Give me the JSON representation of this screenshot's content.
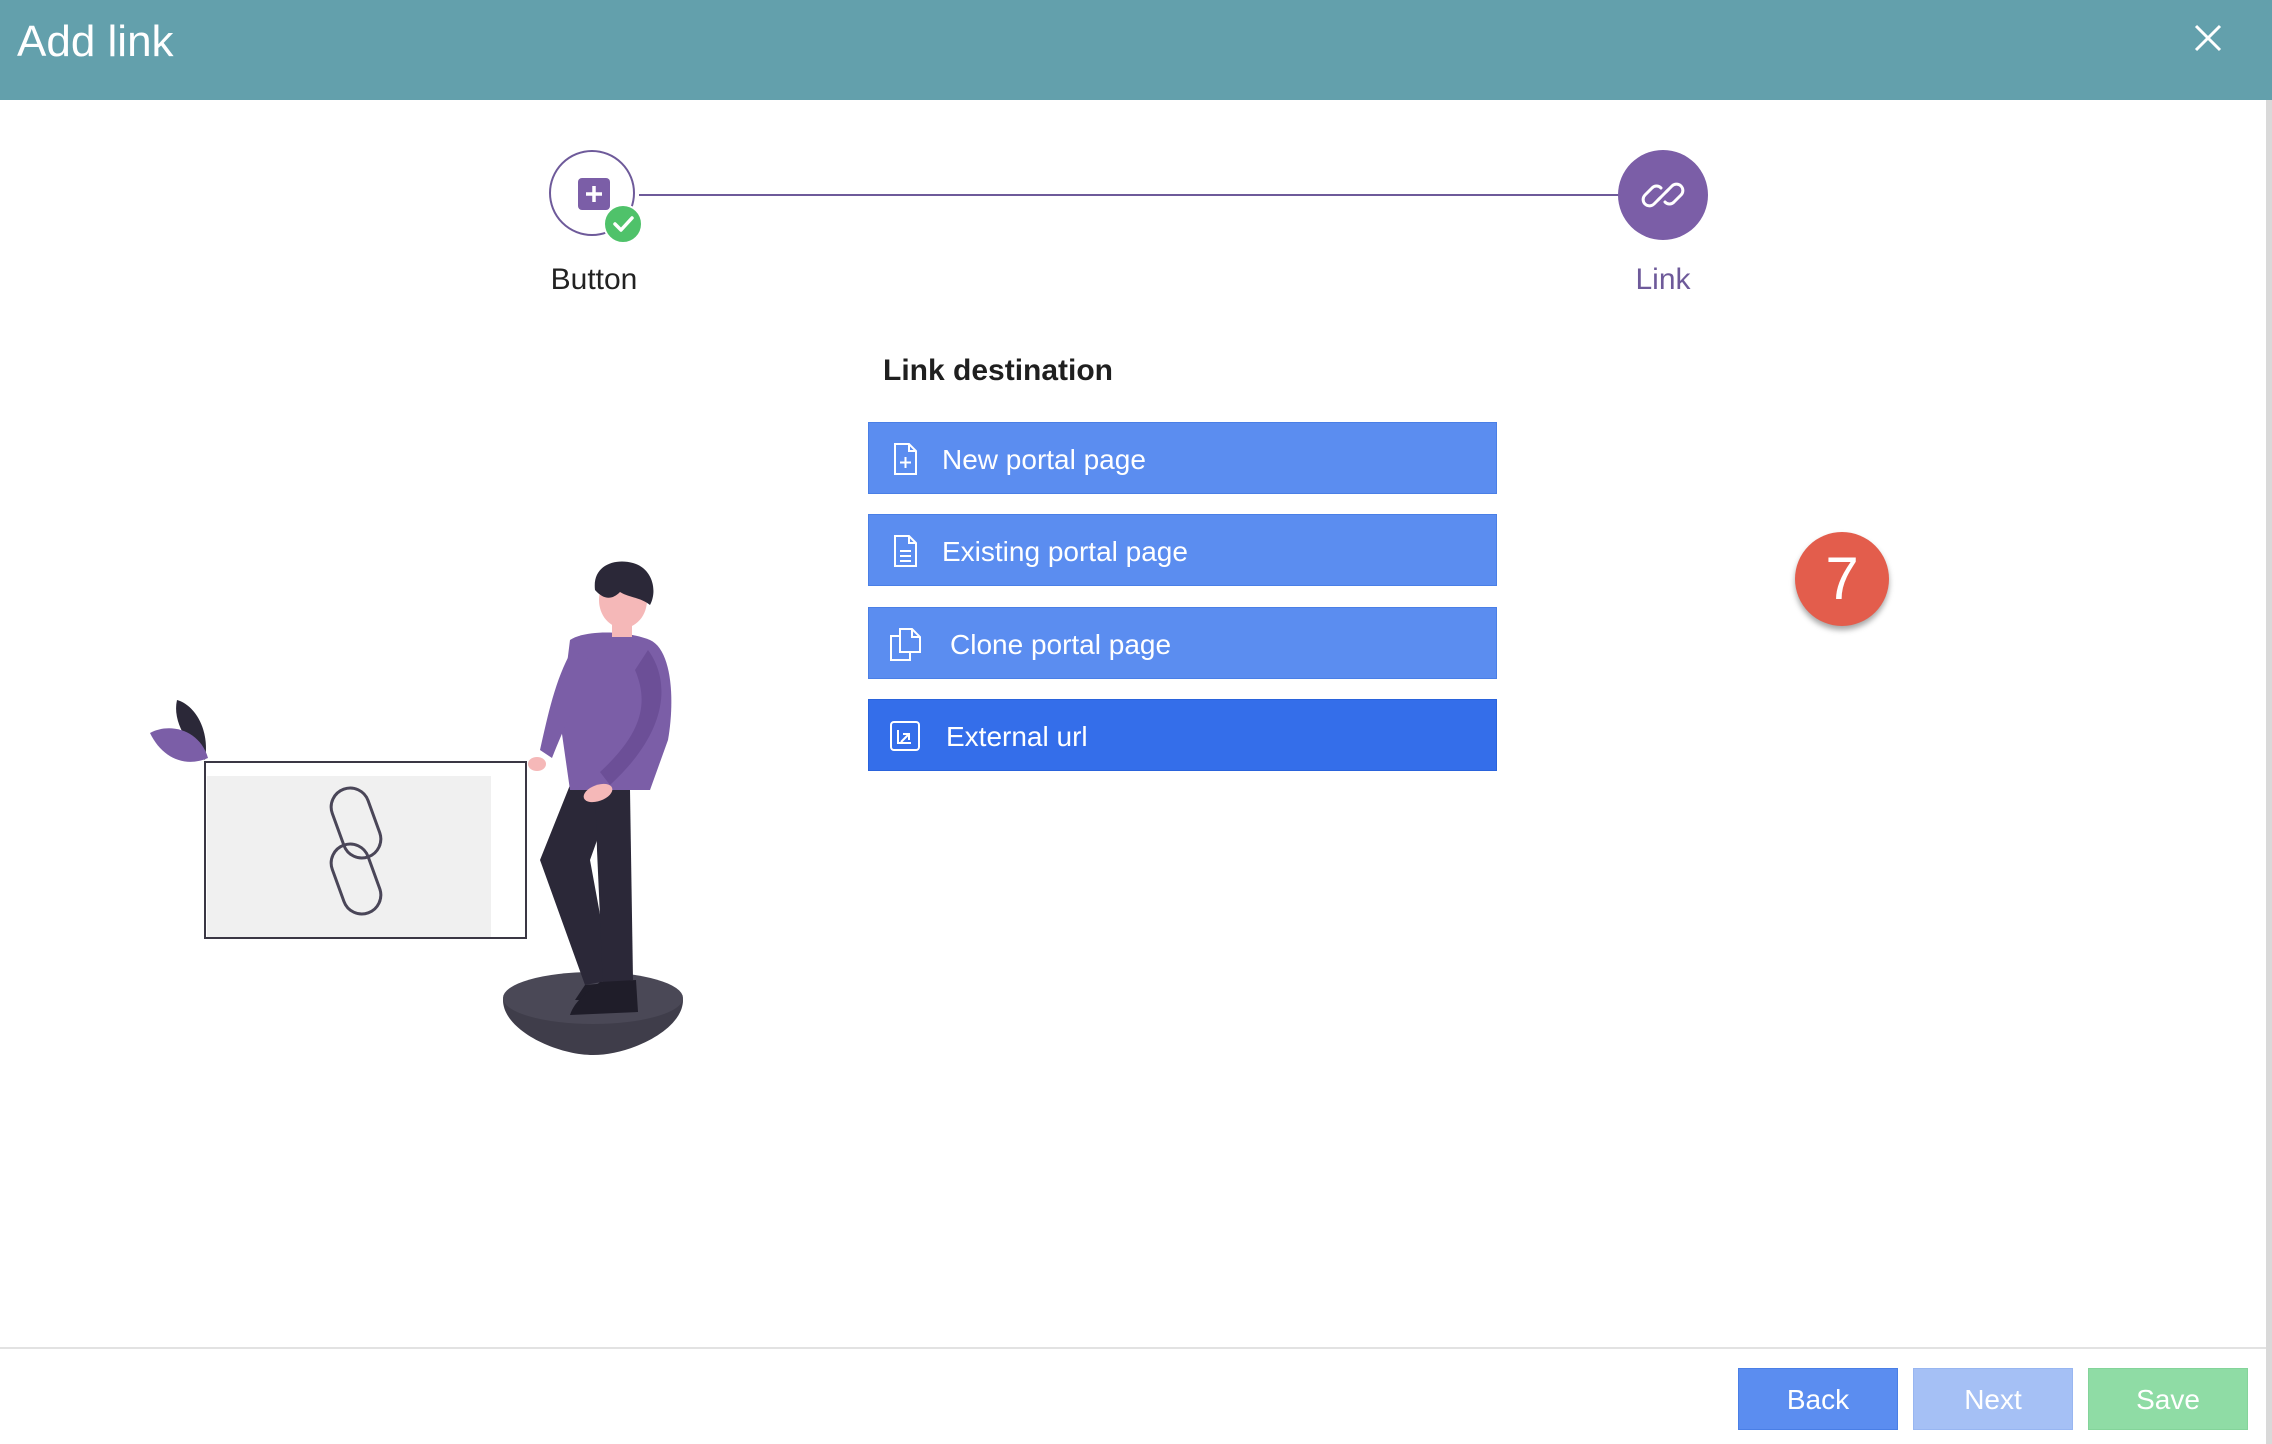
{
  "dialog": {
    "title": "Add link",
    "header_color": "#63a0ac"
  },
  "stepper": {
    "steps": [
      {
        "label": "Button",
        "status": "completed",
        "icon": "plus-square-icon"
      },
      {
        "label": "Link",
        "status": "active",
        "icon": "link-icon"
      }
    ],
    "accent": "#7b5ea7"
  },
  "destination": {
    "title": "Link destination",
    "options": [
      {
        "label": "New portal page",
        "icon": "file-plus-icon",
        "selected": false
      },
      {
        "label": "Existing portal page",
        "icon": "file-text-icon",
        "selected": false
      },
      {
        "label": "Clone portal page",
        "icon": "copy-icon",
        "selected": false
      },
      {
        "label": "External url",
        "icon": "external-link-icon",
        "selected": true
      }
    ],
    "button_color": "#5b8df0",
    "selected_color": "#346eea"
  },
  "annotation": {
    "badge": "7",
    "color": "#e35d4c"
  },
  "footer": {
    "back_label": "Back",
    "next_label": "Next",
    "save_label": "Save"
  }
}
